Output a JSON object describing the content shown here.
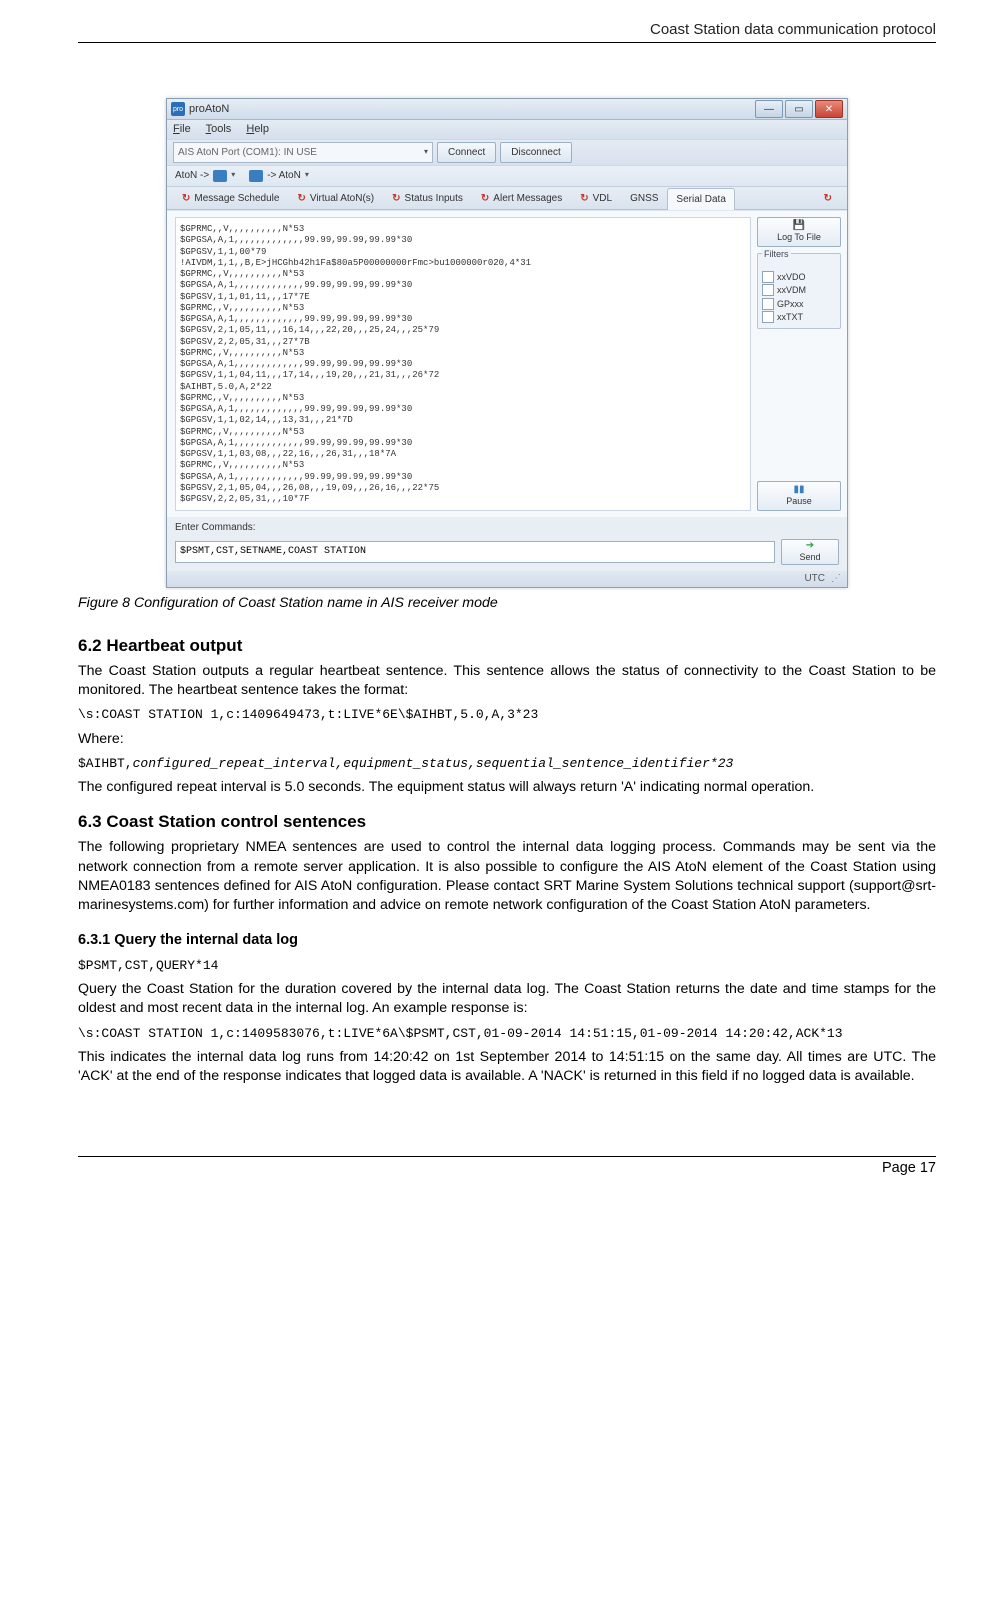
{
  "header_text": "Coast Station data communication protocol",
  "app": {
    "title_icon": "pro",
    "title": "proAtoN",
    "menu": {
      "file": "File",
      "tools": "Tools",
      "help": "Help"
    },
    "port_combo": "AIS AtoN Port (COM1): IN USE",
    "connect": "Connect",
    "disconnect": "Disconnect",
    "aton_left": "AtoN ->",
    "aton_right": "-> AtoN",
    "tabs": {
      "msgsched": "Message Schedule",
      "virtual": "Virtual AtoN(s)",
      "status": "Status Inputs",
      "alert": "Alert Messages",
      "vdl": "VDL",
      "gnss": "GNSS",
      "serial": "Serial Data"
    },
    "serial_lines": "$GPRMC,,V,,,,,,,,,,N*53\n$GPGSA,A,1,,,,,,,,,,,,,99.99,99.99,99.99*30\n$GPGSV,1,1,00*79\n!AIVDM,1,1,,B,E>jHCGhb42h1Fa$80a5P00000000rFmc>bu1000000r020,4*31\n$GPRMC,,V,,,,,,,,,,N*53\n$GPGSA,A,1,,,,,,,,,,,,,99.99,99.99,99.99*30\n$GPGSV,1,1,01,11,,,17*7E\n$GPRMC,,V,,,,,,,,,,N*53\n$GPGSA,A,1,,,,,,,,,,,,,99.99,99.99,99.99*30\n$GPGSV,2,1,05,11,,,16,14,,,22,20,,,25,24,,,25*79\n$GPGSV,2,2,05,31,,,27*7B\n$GPRMC,,V,,,,,,,,,,N*53\n$GPGSA,A,1,,,,,,,,,,,,,99.99,99.99,99.99*30\n$GPGSV,1,1,04,11,,,17,14,,,19,20,,,21,31,,,26*72\n$AIHBT,5.0,A,2*22\n$GPRMC,,V,,,,,,,,,,N*53\n$GPGSA,A,1,,,,,,,,,,,,,99.99,99.99,99.99*30\n$GPGSV,1,1,02,14,,,13,31,,,21*7D\n$GPRMC,,V,,,,,,,,,,N*53\n$GPGSA,A,1,,,,,,,,,,,,,99.99,99.99,99.99*30\n$GPGSV,1,1,03,08,,,22,16,,,26,31,,,18*7A\n$GPRMC,,V,,,,,,,,,,N*53\n$GPGSA,A,1,,,,,,,,,,,,,99.99,99.99,99.99*30\n$GPGSV,2,1,05,04,,,26,08,,,19,09,,,26,16,,,22*75\n$GPGSV,2,2,05,31,,,10*7F",
    "side": {
      "logtofile": "Log To File",
      "pause": "Pause",
      "send": "Send"
    },
    "filters_label": "Filters",
    "filters": [
      "xxVDO",
      "xxVDM",
      "GPxxx",
      "xxTXT"
    ],
    "cmd_label": "Enter Commands:",
    "cmd_value": "$PSMT,CST,SETNAME,COAST STATION",
    "status_right": "UTC"
  },
  "figure_caption": "Figure 8     Configuration of Coast Station name in AIS receiver mode",
  "s62_title": "6.2   Heartbeat output",
  "s62_p1": "The Coast Station outputs a regular heartbeat sentence. This sentence allows the status of connectivity to the Coast Station to be monitored. The heartbeat sentence takes the format:",
  "s62_code1": "\\s:COAST STATION 1,c:1409649473,t:LIVE*6E\\$AIHBT,5.0,A,3*23",
  "s62_where": "Where:",
  "s62_code2_a": "$AIHBT,",
  "s62_code2_b": "configured_repeat_interval,equipment_status,sequential_sentence_identifier*23",
  "s62_p2": "The configured repeat interval is 5.0 seconds. The equipment status will always return 'A' indicating normal operation.",
  "s63_title": "6.3   Coast Station control sentences",
  "s63_p1": "The following proprietary NMEA sentences are used to control the internal data logging process. Commands may be sent via the network connection from a remote server application. It is also possible to configure the AIS AtoN element of the Coast Station using NMEA0183 sentences defined for AIS AtoN configuration. Please contact SRT Marine System Solutions technical support (support@srt-marinesystems.com) for further information and advice on remote network configuration of the Coast Station AtoN parameters.",
  "s631_title": "6.3.1    Query the internal data log",
  "s631_code1": "$PSMT,CST,QUERY*14",
  "s631_p1": "Query the Coast Station for the duration covered by the internal data log. The Coast Station returns the date and time stamps for the oldest and most recent data in the internal log. An example response is:",
  "s631_code2": "\\s:COAST STATION 1,c:1409583076,t:LIVE*6A\\$PSMT,CST,01-09-2014 14:51:15,01-09-2014 14:20:42,ACK*13",
  "s631_p2": "This indicates the internal data log runs from 14:20:42 on 1st September 2014 to 14:51:15 on the same day. All times are UTC. The 'ACK' at the end of the response indicates that logged data is available. A 'NACK' is returned in this field if no logged data is available.",
  "footer_text": "Page 17"
}
